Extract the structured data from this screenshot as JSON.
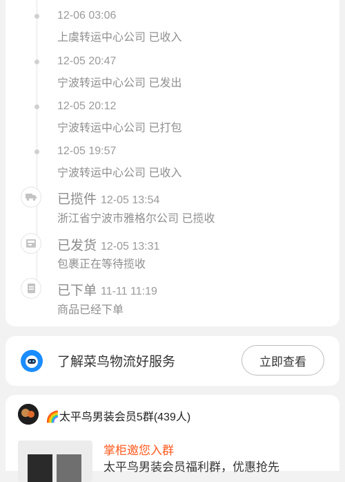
{
  "timeline": {
    "events": [
      {
        "time": "12-06 03:06",
        "desc": "上虞转运中心公司 已收入"
      },
      {
        "time": "12-05 20:47",
        "desc": "宁波转运中心公司 已发出"
      },
      {
        "time": "12-05 20:12",
        "desc": "宁波转运中心公司 已打包"
      },
      {
        "time": "12-05 19:57",
        "desc": "宁波转运中心公司 已收入"
      },
      {
        "status": "已揽件",
        "time": "12-05 13:54",
        "desc": "浙江省宁波市雅格尔公司 已揽收",
        "icon": "truck-icon"
      },
      {
        "status": "已发货",
        "time": "12-05 13:31",
        "desc": "包裹正在等待揽收",
        "icon": "package-icon"
      },
      {
        "status": "已下单",
        "time": "11-11 11:19",
        "desc": "商品已经下单",
        "icon": "document-icon"
      }
    ]
  },
  "service": {
    "text": "了解菜鸟物流好服务",
    "button_label": "立即查看",
    "logo_icon": "cainiao-logo-icon",
    "accent": "#1a8cff"
  },
  "group": {
    "title": "🌈太平鸟男装会员5群(439人)",
    "invite_title": "掌柜邀您入群",
    "invite_sub": "太平鸟男装会员福利群，优惠抢先"
  },
  "colors": {
    "background": "#f2f2f2",
    "card": "#ffffff",
    "invite": "#ff5a1f"
  }
}
